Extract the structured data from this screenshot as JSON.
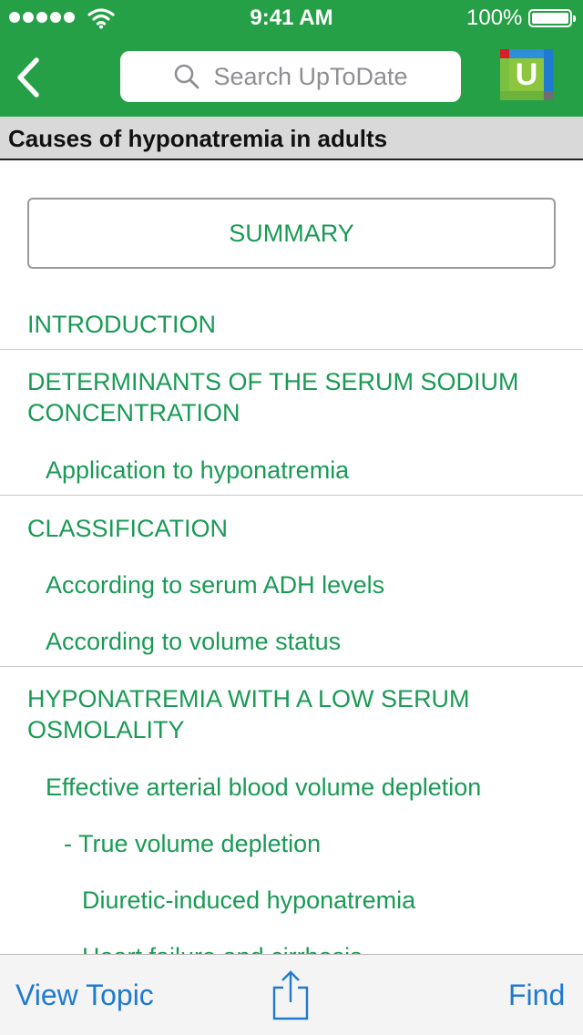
{
  "status_bar": {
    "time": "9:41 AM",
    "battery_percent": "100%",
    "battery_level": 1.0,
    "signal_bars": 5
  },
  "nav": {
    "search_placeholder": "Search UpToDate",
    "logo_letter": "U"
  },
  "topic": {
    "title": "Causes of hyponatremia in adults"
  },
  "summary_label": "SUMMARY",
  "toc": {
    "items": [
      {
        "label": "INTRODUCTION",
        "level": 0
      },
      {
        "label": "DETERMINANTS OF THE SERUM SODIUM",
        "label2": "CONCENTRATION",
        "level": 0
      },
      {
        "label": "Application to hyponatremia",
        "level": 1
      },
      {
        "label": "CLASSIFICATION",
        "level": 0
      },
      {
        "label": "According to serum ADH levels",
        "level": 1
      },
      {
        "label": "According to volume status",
        "level": 1
      },
      {
        "label": "HYPONATREMIA WITH A LOW SERUM",
        "label2": "OSMOLALITY",
        "level": 0
      },
      {
        "label": "Effective arterial blood volume depletion",
        "level": 1
      },
      {
        "label": "- True volume depletion",
        "level": 2
      },
      {
        "label": "Diuretic-induced hyponatremia",
        "level": 3
      },
      {
        "label": "Heart failure and cirrhosis",
        "level": 3
      }
    ]
  },
  "toolbar": {
    "view_topic_label": "View Topic",
    "find_label": "Find"
  },
  "colors": {
    "brand_green": "#25a046",
    "link_green": "#1a9a55",
    "toolbar_blue": "#1f7ad1"
  }
}
